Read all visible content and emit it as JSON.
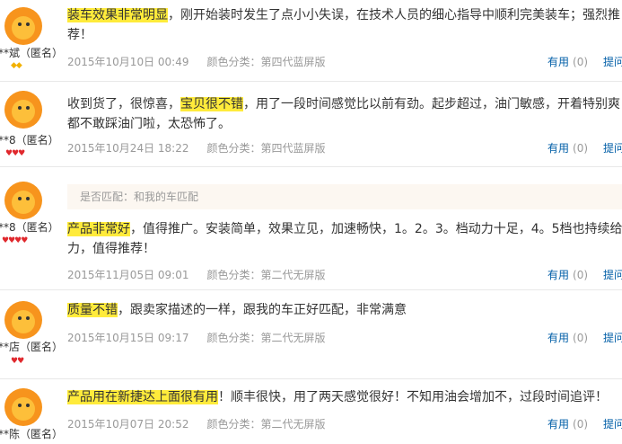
{
  "colors": {
    "highlight": "#ffeb3b",
    "link": "#005ea7",
    "meta": "#999999",
    "avatar": "#f7941d"
  },
  "labels": {
    "useful": "有用",
    "ask": "提问",
    "spec_prefix": "颜色分类："
  },
  "reviews": [
    {
      "user": "**斌（匿名）",
      "badges": "◆◆",
      "highlight": "装车效果非常明显",
      "rest": "，刚开始装时发生了点小小失误，在技术人员的细心指导中顺利完美装车；强烈推荐！",
      "date": "2015年10月10日 00:49",
      "spec": "颜色分类：第四代蓝屏版",
      "useful_count": "(0)"
    },
    {
      "user": "**8（匿名）",
      "badges": "♥♥♥",
      "pre": "收到货了，很惊喜，",
      "highlight": "宝贝很不错",
      "rest": "，用了一段时间感觉比以前有劲。起步超过，油门敏感，开着特别爽都不敢踩油门啦，太恐怖了。",
      "date": "2015年10月24日 18:22",
      "spec": "颜色分类：第四代蓝屏版",
      "useful_count": "(0)"
    },
    {
      "user": "**8（匿名）",
      "badges": "♥♥♥♥",
      "match": "是否匹配：和我的车匹配",
      "highlight": "产品非常好",
      "rest": "，值得推广。安装简单，效果立见，加速畅快，1。2。3。档动力十足，4。5档也持续给力，值得推荐！",
      "date": "2015年11月05日 09:01",
      "spec": "颜色分类：第二代无屏版",
      "useful_count": "(0)"
    },
    {
      "user": "**店（匿名）",
      "badges": "♥♥",
      "highlight": "质量不错",
      "rest": "，跟卖家描述的一样，跟我的车正好匹配，非常满意",
      "date": "2015年10月15日 09:17",
      "spec": "颜色分类：第二代无屏版",
      "useful_count": "(0)"
    },
    {
      "user": "**陈（匿名）",
      "badges": "",
      "highlight": "产品用在新捷达上面很有用",
      "rest": "！顺丰很快，用了两天感觉很好！不知用油会增加不，过段时间追评！",
      "date": "2015年10月07日 20:52",
      "spec": "颜色分类：第二代无屏版",
      "useful_count": "(0)"
    }
  ]
}
